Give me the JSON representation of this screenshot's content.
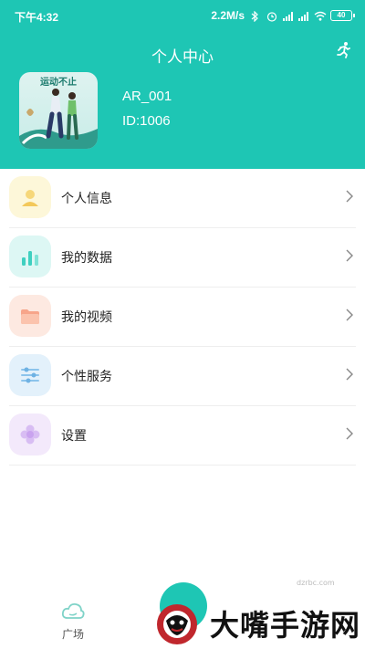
{
  "status_bar": {
    "time": "下午4:32",
    "speed": "2.2M/s",
    "battery": "40"
  },
  "header": {
    "title": "个人中心",
    "avatar_caption": "运动不止",
    "username": "AR_001",
    "user_id": "ID:1006"
  },
  "menu": {
    "items": [
      {
        "label": "个人信息",
        "icon": "person-icon",
        "bg": "#fdf7d9",
        "color": "#f3c85a"
      },
      {
        "label": "我的数据",
        "icon": "bar-chart-icon",
        "bg": "#ddf7f4",
        "color": "#3fd0c0"
      },
      {
        "label": "我的视频",
        "icon": "folder-icon",
        "bg": "#fde9e1",
        "color": "#f7a58a"
      },
      {
        "label": "个性服务",
        "icon": "sliders-icon",
        "bg": "#e3f1fb",
        "color": "#6fb2e3"
      },
      {
        "label": "设置",
        "icon": "flower-icon",
        "bg": "#f3e9fb",
        "color": "#c9a3ef"
      }
    ]
  },
  "bottom_nav": {
    "plaza_label": "广场"
  },
  "watermark": {
    "text": "大嘴手游网",
    "small": "dzrbc.com"
  },
  "colors": {
    "accent": "#1ec6b4"
  }
}
